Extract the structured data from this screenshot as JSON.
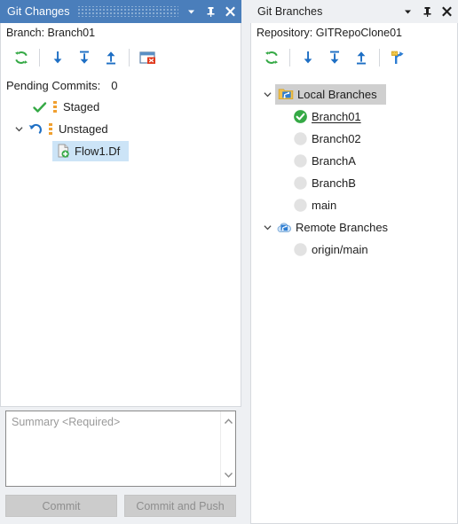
{
  "left_panel": {
    "title": "Git Changes",
    "window_icons": [
      {
        "name": "dropdown-chevron-icon",
        "glyph": "chevron-down"
      },
      {
        "name": "pin-icon",
        "glyph": "pin"
      },
      {
        "name": "close-icon",
        "glyph": "close"
      }
    ],
    "branch_line": "Branch: Branch01",
    "toolbar": [
      {
        "name": "refresh-button",
        "icon": "refresh-icon",
        "color": "#35a945"
      },
      {
        "name": "fetch-button",
        "icon": "arrow-down-icon",
        "color": "#1e6fc4"
      },
      {
        "name": "pull-button",
        "icon": "arrow-down-bar-icon",
        "color": "#1e6fc4"
      },
      {
        "name": "push-button",
        "icon": "arrow-up-bar-icon",
        "color": "#1e6fc4"
      },
      {
        "name": "close-repository-button",
        "icon": "window-close-icon",
        "color": "#e03a1e"
      }
    ],
    "pending_commits_label": "Pending Commits:",
    "pending_commits_count": "0",
    "staged": {
      "label": "Staged",
      "icon": "green-check-icon",
      "expandable": false
    },
    "unstaged": {
      "label": "Unstaged",
      "icon": "undo-arrow-icon",
      "expandable": true,
      "expanded": true,
      "files": [
        {
          "name": "Flow1.Df",
          "icon": "file-added-icon",
          "selected": true
        }
      ]
    },
    "commit": {
      "summary_placeholder": "Summary <Required>",
      "summary_value": "",
      "commit_button": "Commit",
      "commit_and_push_button": "Commit and Push",
      "buttons_enabled": false
    }
  },
  "right_panel": {
    "title": "Git Branches",
    "window_icons": [
      {
        "name": "dropdown-chevron-icon",
        "glyph": "chevron-down"
      },
      {
        "name": "pin-icon",
        "glyph": "pin"
      },
      {
        "name": "close-icon",
        "glyph": "close"
      }
    ],
    "repository_line": "Repository: GITRepoClone01",
    "toolbar": [
      {
        "name": "refresh-button",
        "icon": "refresh-icon",
        "color": "#35a945"
      },
      {
        "name": "fetch-button",
        "icon": "arrow-down-icon",
        "color": "#1e6fc4"
      },
      {
        "name": "pull-button",
        "icon": "arrow-down-bar-icon",
        "color": "#1e6fc4"
      },
      {
        "name": "push-button",
        "icon": "arrow-up-bar-icon",
        "color": "#1e6fc4"
      },
      {
        "name": "new-branch-button",
        "icon": "new-branch-icon",
        "color": "#1e6fc4"
      }
    ],
    "groups": [
      {
        "label": "Local Branches",
        "icon": "folder-branch-icon",
        "expanded": true,
        "selected": true,
        "branches": [
          {
            "name": "Branch01",
            "state": "current",
            "underlined": true
          },
          {
            "name": "Branch02",
            "state": "inactive",
            "underlined": false
          },
          {
            "name": "BranchA",
            "state": "inactive",
            "underlined": false
          },
          {
            "name": "BranchB",
            "state": "inactive",
            "underlined": false
          },
          {
            "name": "main",
            "state": "inactive",
            "underlined": false
          }
        ]
      },
      {
        "label": "Remote Branches",
        "icon": "cloud-branch-icon",
        "expanded": true,
        "selected": false,
        "branches": [
          {
            "name": "origin/main",
            "state": "inactive",
            "underlined": false
          }
        ]
      }
    ]
  },
  "colors": {
    "active_title_bg": "#4a7ebb",
    "inactive_title_bg": "#eef0f3",
    "selection_blue": "#cce4f7",
    "selection_gray": "#cfcfcf",
    "green": "#35a945",
    "blue": "#1e6fc4",
    "orange": "#f0a030"
  }
}
